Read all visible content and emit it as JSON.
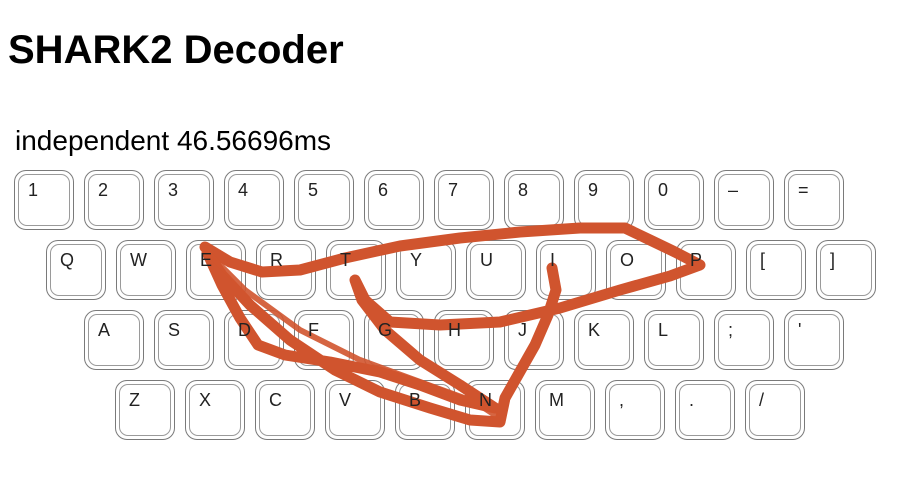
{
  "title": "SHARK2 Decoder",
  "result": {
    "word": "independent",
    "time": "46.56696ms"
  },
  "keyboard": {
    "rows": [
      [
        "1",
        "2",
        "3",
        "4",
        "5",
        "6",
        "7",
        "8",
        "9",
        "0",
        "–",
        "="
      ],
      [
        "Q",
        "W",
        "E",
        "R",
        "T",
        "Y",
        "U",
        "I",
        "O",
        "P",
        "[",
        "]"
      ],
      [
        "A",
        "S",
        "D",
        "F",
        "G",
        "H",
        "J",
        "K",
        "L",
        ";",
        "'"
      ],
      [
        "Z",
        "X",
        "C",
        "V",
        "B",
        "N",
        "M",
        ",",
        ".",
        "/"
      ]
    ]
  },
  "gesture": {
    "color": "#d0542e",
    "word": "independent"
  }
}
